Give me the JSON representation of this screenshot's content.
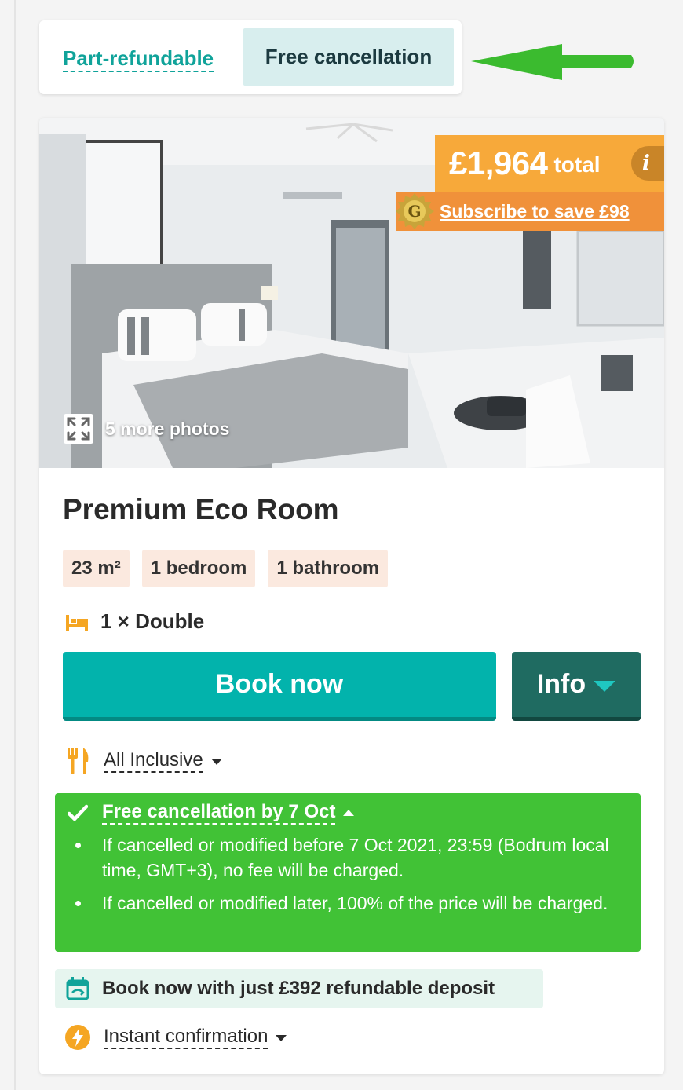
{
  "tabs": {
    "part_refundable": "Part-refundable",
    "free_cancellation": "Free cancellation"
  },
  "price": {
    "amount": "£1,964",
    "suffix": "total",
    "info_icon": "i",
    "subscribe": "Subscribe to save £98",
    "badge_letter": "G"
  },
  "photos": {
    "more_label": "5 more photos"
  },
  "room": {
    "title": "Premium Eco Room",
    "chips": [
      "23 m²",
      "1 bedroom",
      "1 bathroom"
    ],
    "bed": "1 × Double"
  },
  "actions": {
    "book": "Book now",
    "info": "Info"
  },
  "board": {
    "label": "All Inclusive"
  },
  "cancellation": {
    "title": "Free cancellation by 7 Oct",
    "items": [
      "If cancelled or modified before 7 Oct 2021, 23:59 (Bodrum local time, GMT+3), no fee will be charged.",
      "If cancelled or modified later, 100% of the price will be charged."
    ]
  },
  "deposit": {
    "text": "Book now with just £392 refundable deposit"
  },
  "instant": {
    "label": "Instant confirmation"
  },
  "colors": {
    "teal": "#02b3ac",
    "dark_green": "#1f6b61",
    "green": "#41c236",
    "orange": "#f7a93a",
    "orange_dark": "#f0913a"
  },
  "icons": [
    "arrow-left-icon",
    "gold-badge-icon",
    "expand-icon",
    "bed-icon",
    "cutlery-icon",
    "check-icon",
    "calendar-icon",
    "lightning-icon"
  ]
}
